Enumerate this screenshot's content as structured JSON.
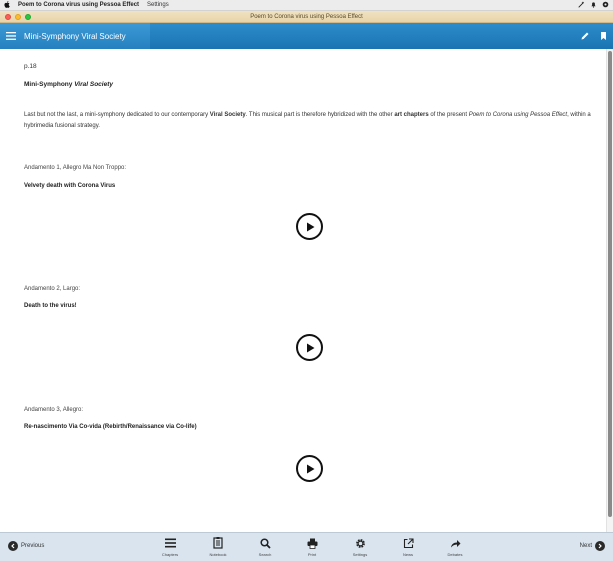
{
  "menubar": {
    "apple": "",
    "app_name": "Poem to Corona virus using Pessoa Effect",
    "menus": [
      "Settings"
    ]
  },
  "window": {
    "title": "Poem to Corona virus using Pessoa Effect"
  },
  "appbar": {
    "title": "Mini-Symphony Viral Society",
    "menu_icon": "hamburger-icon",
    "edit_icon": "pencil-icon",
    "bookmark_icon": "bookmark-icon",
    "accent_color": "#1f7bbd"
  },
  "content": {
    "page_number": "p.18",
    "heading_plain": "Mini-Symphony ",
    "heading_italic": "Viral Society",
    "intro": {
      "part1": "Last but not the last, a mini-symphony dedicated to our contemporary ",
      "bold1": "Viral Society",
      "part2": ". This musical part is therefore hybridized with the other ",
      "bold2": "art chapters",
      "part3": " of the present ",
      "italic1": "Poem to Corona using Pessoa Effect",
      "part4": ", within a hybrimedia fusional strategy."
    },
    "movements": [
      {
        "label": "Andamento 1, Allegro Ma Non Troppo:",
        "title": "Velvety death with Corona Virus"
      },
      {
        "label": "Andamento 2, Largo:",
        "title": "Death to the virus!"
      },
      {
        "label": "Andamento 3, Allegro:",
        "title": "Re-nascimento Via Co-vida (Rebirth/Renaissance via Co-life)"
      }
    ]
  },
  "toolbar": {
    "previous": "Previous",
    "next": "Next",
    "tools": [
      {
        "label": "Chapters",
        "icon": "list-icon"
      },
      {
        "label": "Notebook",
        "icon": "notebook-icon"
      },
      {
        "label": "Search",
        "icon": "search-icon"
      },
      {
        "label": "Print",
        "icon": "print-icon"
      },
      {
        "label": "Settings",
        "icon": "gear-icon"
      },
      {
        "label": "News",
        "icon": "external-link-icon"
      },
      {
        "label": "Debates",
        "icon": "share-arrow-icon"
      }
    ]
  }
}
